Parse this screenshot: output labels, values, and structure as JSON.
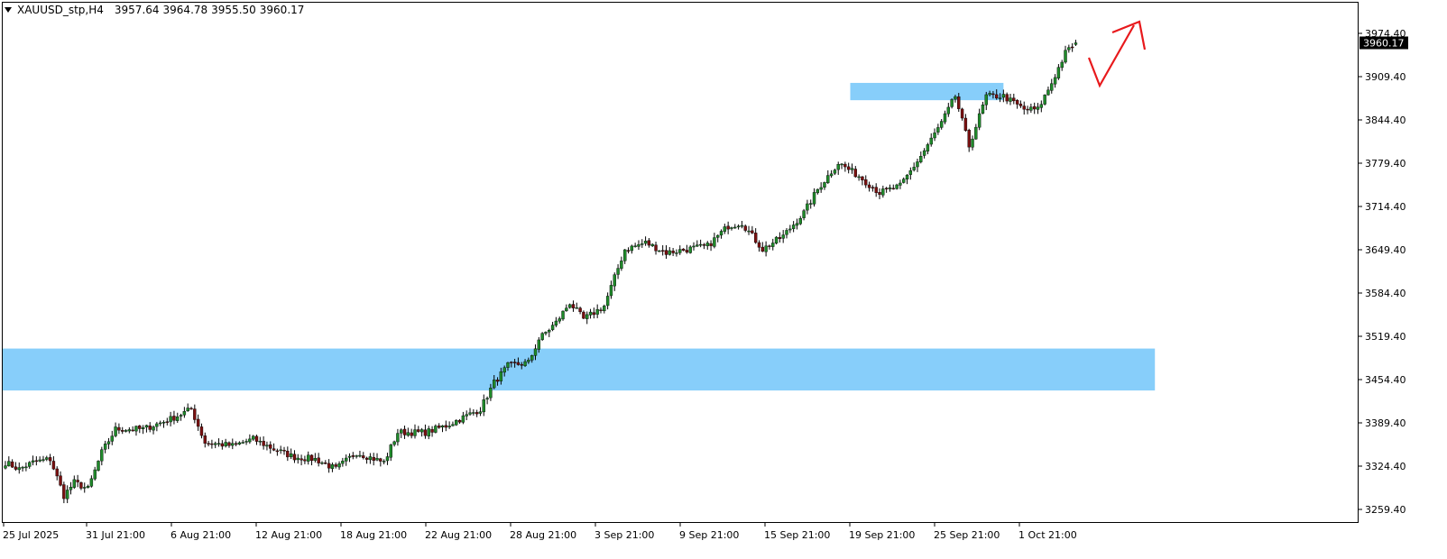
{
  "header": {
    "symbol_timeframe": "XAUUSD_stp,H4",
    "open": "3957.64",
    "high": "3964.78",
    "low": "3955.50",
    "close": "3960.17"
  },
  "price_axis": {
    "labels": [
      "3974.40",
      "3909.40",
      "3844.40",
      "3779.40",
      "3714.40",
      "3649.40",
      "3584.40",
      "3519.40",
      "3454.40",
      "3389.40",
      "3324.40",
      "3259.40"
    ],
    "current_price_label": "3960.17"
  },
  "time_axis": {
    "labels": [
      "25 Jul 2025",
      "31 Jul 21:00",
      "6 Aug 21:00",
      "12 Aug 21:00",
      "18 Aug 21:00",
      "22 Aug 21:00",
      "28 Aug 21:00",
      "3 Sep 21:00",
      "9 Sep 21:00",
      "15 Sep 21:00",
      "19 Sep 21:00",
      "25 Sep 21:00",
      "1 Oct 21:00"
    ]
  },
  "colors": {
    "bull_candle": "#1f8a2a",
    "bear_candle": "#7a1010",
    "wick": "#000000",
    "zone_fill": "#87cefa",
    "arrow": "#e8191c",
    "current_price_bg": "#000000",
    "current_price_text": "#ffffff"
  },
  "zones": [
    {
      "name": "demand-zone-large",
      "price_top": 3501,
      "price_bottom": 3438,
      "bar_start": 0,
      "bar_end": 334
    },
    {
      "name": "support-zone-small",
      "price_top": 3900,
      "price_bottom": 3874,
      "bar_start": 246,
      "bar_end": 290
    }
  ],
  "chart_data": {
    "type": "candlestick",
    "symbol": "XAUUSD_stp",
    "timeframe": "H4",
    "y_range": [
      3244,
      4014
    ],
    "anchors": [
      {
        "bar": 0,
        "price": 3330
      },
      {
        "bar": 4,
        "price": 3320
      },
      {
        "bar": 8,
        "price": 3330
      },
      {
        "bar": 13,
        "price": 3335
      },
      {
        "bar": 17,
        "price": 3280
      },
      {
        "bar": 20,
        "price": 3300
      },
      {
        "bar": 24,
        "price": 3290
      },
      {
        "bar": 28,
        "price": 3345
      },
      {
        "bar": 32,
        "price": 3380
      },
      {
        "bar": 40,
        "price": 3380
      },
      {
        "bar": 48,
        "price": 3395
      },
      {
        "bar": 54,
        "price": 3410
      },
      {
        "bar": 58,
        "price": 3360
      },
      {
        "bar": 66,
        "price": 3355
      },
      {
        "bar": 72,
        "price": 3365
      },
      {
        "bar": 78,
        "price": 3350
      },
      {
        "bar": 84,
        "price": 3338
      },
      {
        "bar": 90,
        "price": 3335
      },
      {
        "bar": 96,
        "price": 3320
      },
      {
        "bar": 102,
        "price": 3345
      },
      {
        "bar": 110,
        "price": 3330
      },
      {
        "bar": 114,
        "price": 3375
      },
      {
        "bar": 122,
        "price": 3375
      },
      {
        "bar": 128,
        "price": 3385
      },
      {
        "bar": 134,
        "price": 3400
      },
      {
        "bar": 138,
        "price": 3410
      },
      {
        "bar": 142,
        "price": 3450
      },
      {
        "bar": 146,
        "price": 3475
      },
      {
        "bar": 152,
        "price": 3480
      },
      {
        "bar": 155,
        "price": 3515
      },
      {
        "bar": 160,
        "price": 3540
      },
      {
        "bar": 164,
        "price": 3570
      },
      {
        "bar": 168,
        "price": 3545
      },
      {
        "bar": 174,
        "price": 3565
      },
      {
        "bar": 180,
        "price": 3650
      },
      {
        "bar": 186,
        "price": 3660
      },
      {
        "bar": 192,
        "price": 3645
      },
      {
        "bar": 198,
        "price": 3650
      },
      {
        "bar": 204,
        "price": 3655
      },
      {
        "bar": 210,
        "price": 3685
      },
      {
        "bar": 214,
        "price": 3690
      },
      {
        "bar": 220,
        "price": 3650
      },
      {
        "bar": 226,
        "price": 3670
      },
      {
        "bar": 232,
        "price": 3705
      },
      {
        "bar": 236,
        "price": 3740
      },
      {
        "bar": 242,
        "price": 3780
      },
      {
        "bar": 248,
        "price": 3760
      },
      {
        "bar": 254,
        "price": 3735
      },
      {
        "bar": 260,
        "price": 3745
      },
      {
        "bar": 266,
        "price": 3790
      },
      {
        "bar": 272,
        "price": 3840
      },
      {
        "bar": 276,
        "price": 3880
      },
      {
        "bar": 280,
        "price": 3805
      },
      {
        "bar": 285,
        "price": 3880
      },
      {
        "bar": 290,
        "price": 3880
      },
      {
        "bar": 296,
        "price": 3860
      },
      {
        "bar": 300,
        "price": 3860
      },
      {
        "bar": 304,
        "price": 3900
      },
      {
        "bar": 308,
        "price": 3945
      },
      {
        "bar": 311,
        "price": 3960
      }
    ],
    "last_bar": {
      "open": 3957.64,
      "high": 3964.78,
      "low": 3955.5,
      "close": 3960.17
    }
  }
}
